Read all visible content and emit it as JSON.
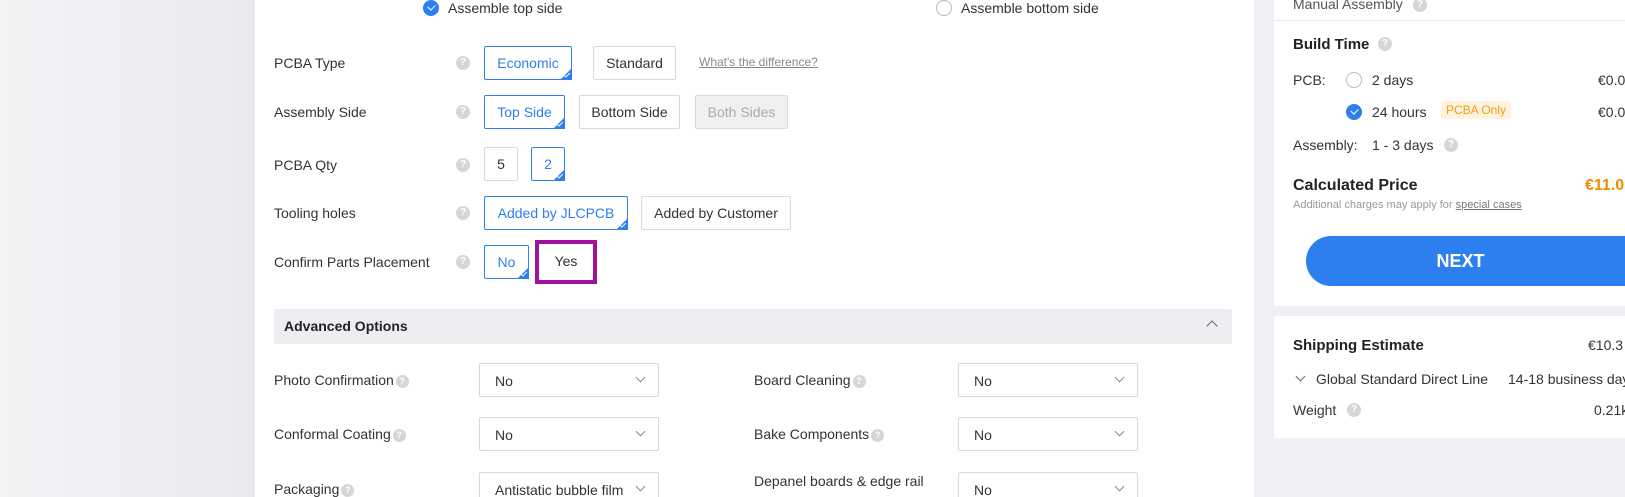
{
  "assemble": {
    "top_label": "Assemble top side",
    "bottom_label": "Assemble bottom side"
  },
  "rows": {
    "pcba_type": {
      "label": "PCBA Type",
      "options": [
        "Economic",
        "Standard"
      ],
      "link": "What's the difference?"
    },
    "assembly_side": {
      "label": "Assembly Side",
      "options": [
        "Top Side",
        "Bottom Side",
        "Both Sides"
      ]
    },
    "pcba_qty": {
      "label": "PCBA Qty",
      "options": [
        "5",
        "2"
      ]
    },
    "tooling_holes": {
      "label": "Tooling holes",
      "options": [
        "Added by JLCPCB",
        "Added by Customer"
      ]
    },
    "confirm_parts": {
      "label": "Confirm Parts Placement",
      "options": [
        "No",
        "Yes"
      ]
    }
  },
  "advanced": {
    "title": "Advanced Options",
    "fields": {
      "photo": {
        "label": "Photo Confirmation",
        "value": "No"
      },
      "cleaning": {
        "label": "Board Cleaning",
        "value": "No"
      },
      "conformal": {
        "label": "Conformal Coating",
        "value": "No"
      },
      "bake": {
        "label": "Bake Components",
        "value": "No"
      },
      "packaging": {
        "label": "Packaging",
        "value": "Antistatic bubble film"
      },
      "depanel": {
        "label": "Depanel boards & edge rail",
        "value": "No"
      }
    }
  },
  "summary": {
    "manual_assembly": "Manual Assembly",
    "build_time_title": "Build Time",
    "pcb_label": "PCB:",
    "option_2days": "2 days",
    "option_24h": "24 hours",
    "pcba_only_tag": "PCBA Only",
    "price_2days": "€0.0",
    "price_24h": "€0.0",
    "assembly_label": "Assembly:",
    "assembly_days": "1 - 3 days",
    "calc_price_label": "Calculated Price",
    "calc_price": "€11.0",
    "charges_note": "Additional charges may apply for",
    "special_cases": "special cases",
    "next_label": "NEXT"
  },
  "shipping": {
    "title": "Shipping Estimate",
    "price": "€10.3",
    "method": "Global Standard Direct Line",
    "days": "14-18 business day",
    "weight_label": "Weight",
    "weight": "0.21k"
  },
  "colors": {
    "accent": "#2d7ff0",
    "price": "#f38b00",
    "highlight": "#a0119e"
  }
}
